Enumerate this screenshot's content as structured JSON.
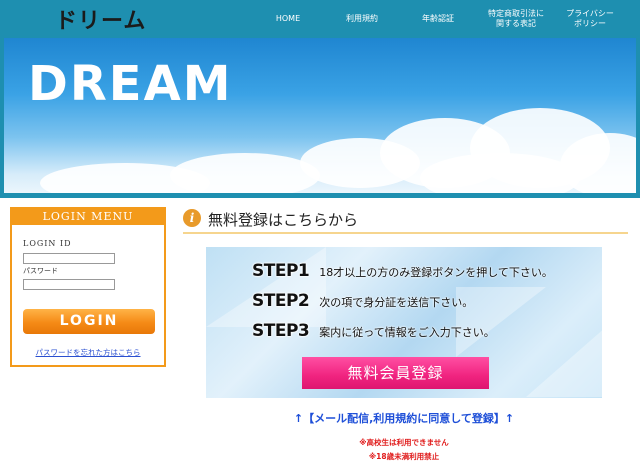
{
  "header": {
    "logo": "ドリーム",
    "nav": [
      {
        "label": "HOME"
      },
      {
        "label": "利用規約"
      },
      {
        "label": "年齢認証"
      },
      {
        "label": "特定商取引法に\n関する表記"
      },
      {
        "label": "プライバシー\nポリシー"
      }
    ]
  },
  "hero": {
    "title": "DREAM"
  },
  "login": {
    "header": "LOGIN MENU",
    "id_label": "LOGIN ID",
    "password_label": "パスワード",
    "id_value": "",
    "password_value": "",
    "button": "LOGIN",
    "forgot_link": "パスワードを忘れた方はこちら"
  },
  "registration": {
    "title": "無料登録はこちらから",
    "info_icon": "i",
    "steps": [
      {
        "key": "STEP1",
        "text": "18才以上の方のみ登録ボタンを押して下さい。"
      },
      {
        "key": "STEP2",
        "text": "次の項で身分証を送信下さい。"
      },
      {
        "key": "STEP3",
        "text": "案内に従って情報をご入力下さい。"
      }
    ],
    "button": "無料会員登録",
    "agree_note": "↑【メール配信,利用規約に同意して登録】↑",
    "warnings": [
      "※高校生は利用できません",
      "※18歳未満利用禁止"
    ]
  },
  "colors": {
    "header_bg": "#1e8fb0",
    "login_accent": "#f39a1a",
    "register_button": "#f0237f",
    "link_blue": "#2a4fd0",
    "warning_red": "#e01c1c"
  }
}
